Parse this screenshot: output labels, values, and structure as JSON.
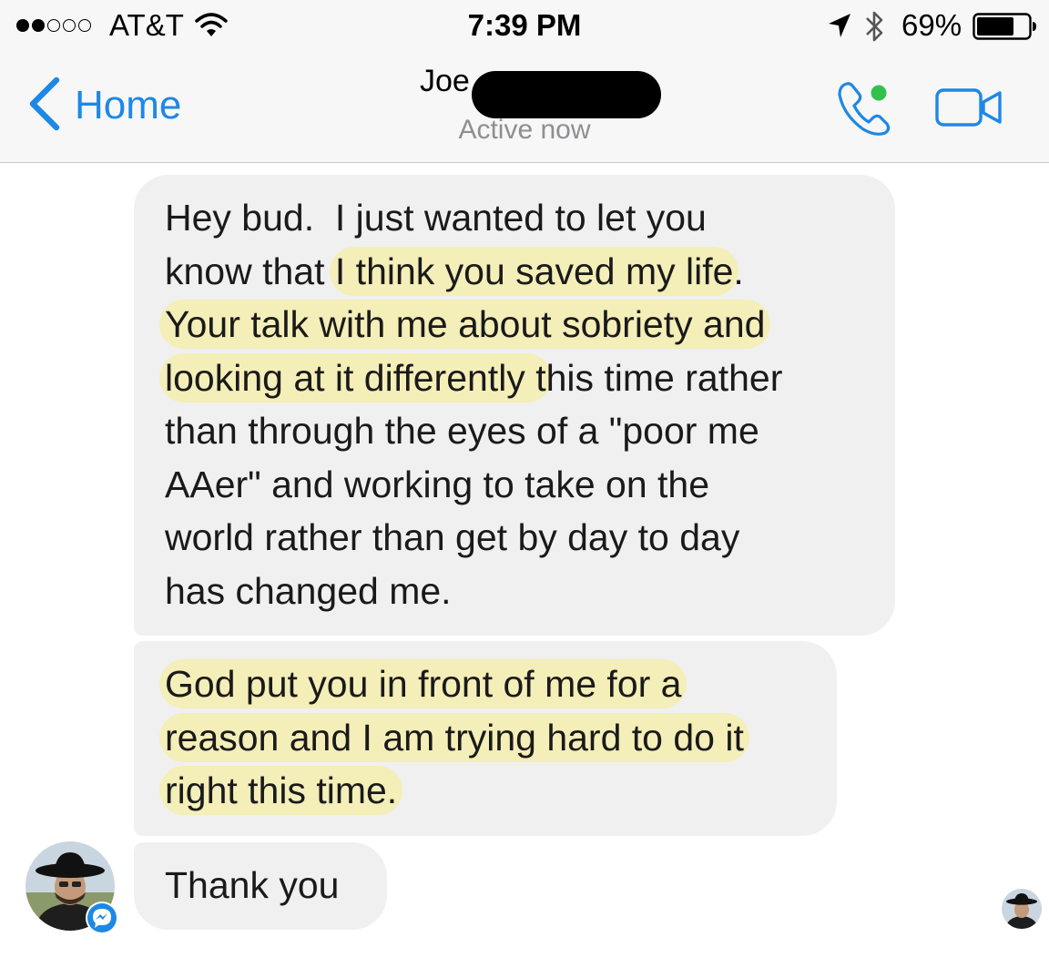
{
  "status_bar": {
    "carrier": "AT&T",
    "time": "7:39 PM",
    "battery": "69%",
    "signal_bars_filled": 2,
    "signal_bars_total": 5
  },
  "header": {
    "back_label": "Home",
    "contact_name": "Joe",
    "status": "Active now",
    "accent_color": "#1e88e5",
    "online_color": "#31c24d"
  },
  "messages": [
    {
      "lines": [
        [
          {
            "t": "Hey bud.  I just wanted to let you"
          }
        ],
        [
          {
            "t": "know that "
          },
          {
            "t": "I think you saved my life",
            "hl": true
          },
          {
            "t": "."
          }
        ],
        [
          {
            "t": "Your talk with me about sobriety and",
            "hl": true
          }
        ],
        [
          {
            "t": "looking at it differently t",
            "hl": true
          },
          {
            "t": "his time rather"
          }
        ],
        [
          {
            "t": "than through the eyes of a \"poor me"
          }
        ],
        [
          {
            "t": "AAer\" and working to take on the"
          }
        ],
        [
          {
            "t": "world rather than get by day to day"
          }
        ],
        [
          {
            "t": "has changed me."
          }
        ]
      ]
    },
    {
      "lines": [
        [
          {
            "t": "God put you in front of me for a",
            "hl": true
          }
        ],
        [
          {
            "t": "reason and I am trying hard to do it",
            "hl": true
          }
        ],
        [
          {
            "t": "right this time.",
            "hl": true
          }
        ]
      ]
    },
    {
      "lines": [
        [
          {
            "t": "Thank you"
          }
        ]
      ]
    }
  ]
}
